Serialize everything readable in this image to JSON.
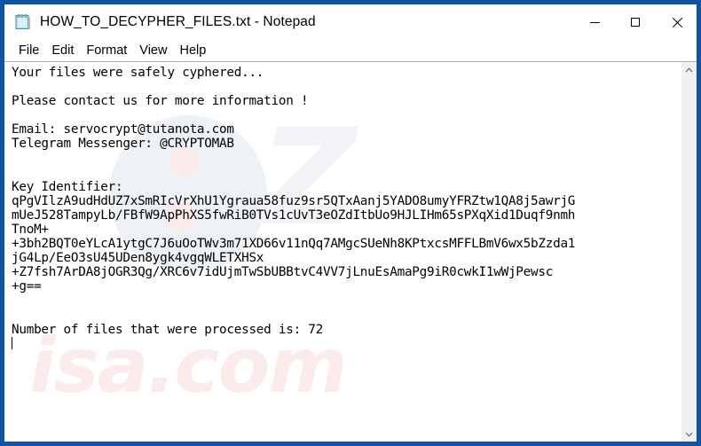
{
  "window": {
    "title": "HOW_TO_DECYPHER_FILES.txt - Notepad",
    "icon": "notepad-icon",
    "frame_color": "#1055a5",
    "controls": {
      "minimize": "minimize-icon",
      "maximize": "maximize-icon",
      "close": "close-icon"
    }
  },
  "menubar": {
    "items": [
      {
        "label": "File"
      },
      {
        "label": "Edit"
      },
      {
        "label": "Format"
      },
      {
        "label": "View"
      },
      {
        "label": "Help"
      }
    ]
  },
  "document": {
    "lines": [
      "Your files were safely cyphered...",
      "",
      "Please contact us for more information !",
      "",
      "Email: servocrypt@tutanota.com",
      "Telegram Messenger: @CRYPTOMAB",
      "",
      "",
      "Key Identifier:",
      "qPgVIlzA9udHdUZ7xSmRIcVrXhU1Ygraua58fuz9sr5QTxAanj5YADO8umyYFRZtw1QA8j5awrjG",
      "mUeJ528TampyLb/FBfW9ApPhXS5fwRiB0TVs1cUvT3eOZdItbUo9HJLIHm65sPXqXid1Duqf9nmh",
      "TnoM+",
      "+3bh2BQT0eYLcA1ytgC7J6uOoTWv3m71XD66v11nQq7AMgcSUeNh8KPtxcsMFFLBmV6wx5bZzda1",
      "jG4Lp/EeO3sU45UDen8ygk4vgqWLETXHSx",
      "+Z7fsh7ArDA8jOGR3Qg/XRC6v7idUjmTwSbUBBtvC4VV7jLnuEsAmaPg9iR0cwkI1wWjPewsc",
      "+g==",
      "",
      "",
      "Number of files that were processed is: 72"
    ],
    "email": "servocrypt@tutanota.com",
    "telegram": "@CRYPTOMAB",
    "files_processed": "72"
  },
  "scrollbar": {
    "up_arrow": "chevron-up-icon",
    "down_arrow": "chevron-down-icon"
  },
  "watermark": {
    "text": "isa.com"
  }
}
